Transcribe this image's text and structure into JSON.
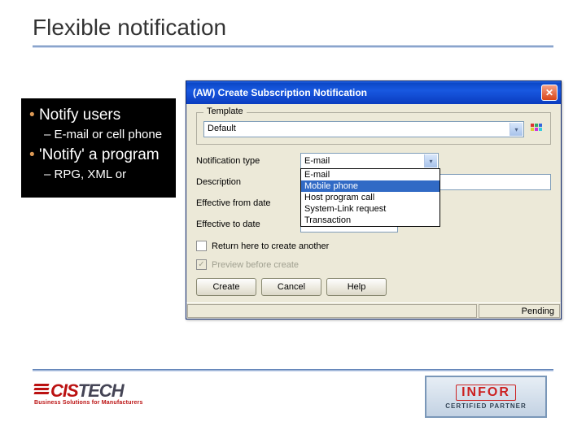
{
  "slide": {
    "title": "Flexible notification",
    "bullets": {
      "b1": "Notify users",
      "b1a": "E-mail or cell phone",
      "b2": "'Notify' a program",
      "b2a": "RPG, XML or"
    }
  },
  "window": {
    "title": "(AW) Create Subscription Notification",
    "template": {
      "legend": "Template",
      "value": "Default"
    },
    "labels": {
      "notification_type": "Notification type",
      "description": "Description",
      "eff_from": "Effective from date",
      "eff_to": "Effective to date"
    },
    "fields": {
      "notification_type_value": "E-mail",
      "description_value": "",
      "eff_from_value": "",
      "eff_to_value": ""
    },
    "dropdown": [
      "E-mail",
      "Mobile phone",
      "Host program call",
      "System-Link request",
      "Transaction"
    ],
    "checkboxes": {
      "return_here": "Return here to create another",
      "preview": "Preview before create"
    },
    "buttons": {
      "create": "Create",
      "cancel": "Cancel",
      "help": "Help"
    },
    "status": {
      "pending": "Pending"
    }
  },
  "footer": {
    "cistech": {
      "prefix": "CIS",
      "suffix": "TECH",
      "tag": "Business Solutions for Manufacturers"
    },
    "infor": {
      "brand": "INFOR",
      "cp": "CERTIFIED PARTNER"
    }
  }
}
